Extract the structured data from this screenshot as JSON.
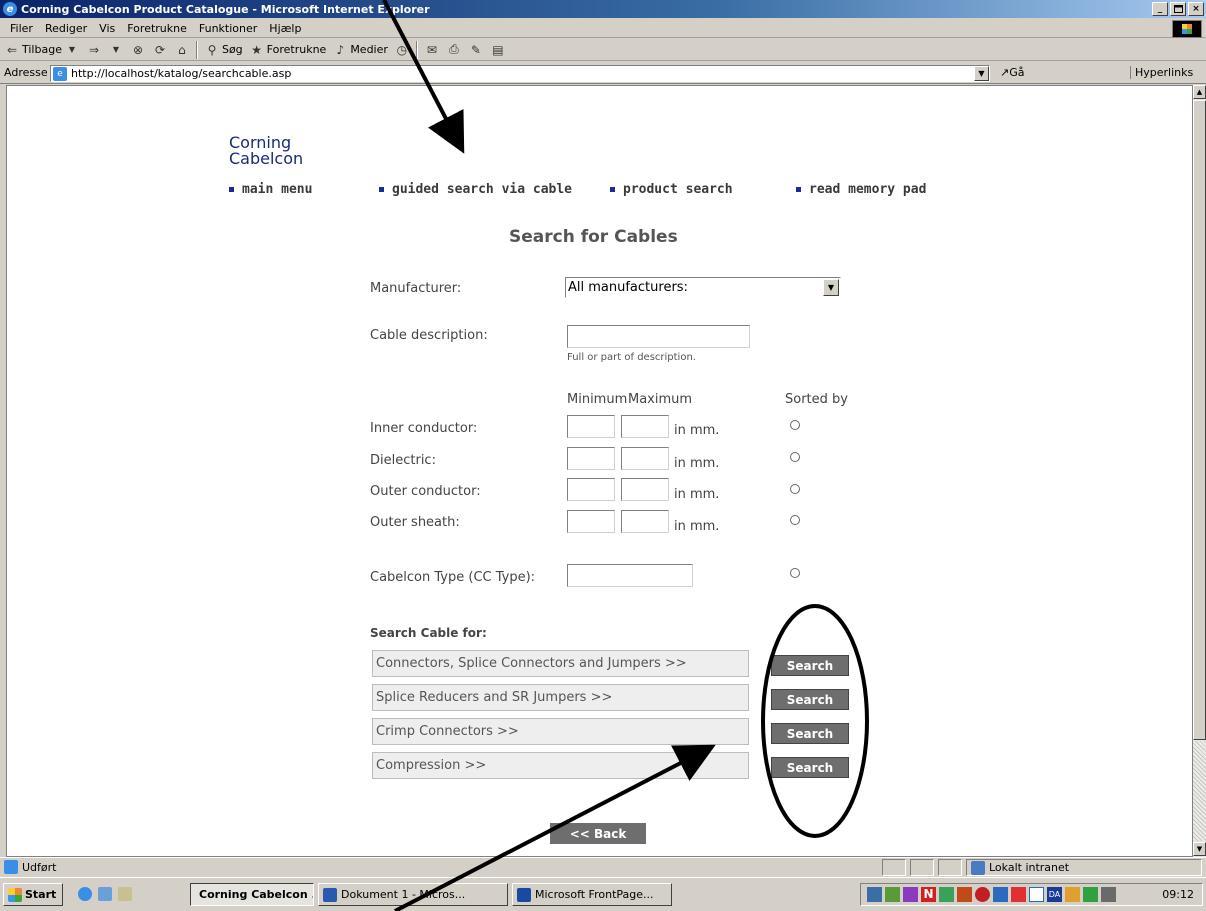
{
  "window": {
    "title": "Corning Cabelcon Product Catalogue - Microsoft Internet Explorer",
    "controls": [
      "_",
      "×"
    ]
  },
  "menu": [
    "Filer",
    "Rediger",
    "Vis",
    "Foretrukne",
    "Funktioner",
    "Hjælp"
  ],
  "toolbar": {
    "back": "Tilbage",
    "search": "Søg",
    "favorites": "Foretrukne",
    "media": "Medier"
  },
  "address": {
    "label": "Adresse",
    "url": "http://localhost/katalog/searchcable.asp",
    "go": "Gå",
    "links": "Hyperlinks"
  },
  "page": {
    "logo_line1": "Corning",
    "logo_line2": "Cabelcon",
    "nav": [
      "main menu",
      "guided search via cable",
      "product search",
      "read memory pad"
    ],
    "heading": "Search for Cables",
    "manufacturer_label": "Manufacturer:",
    "manufacturer_value": "All manufacturers:",
    "cable_desc_label": "Cable description:",
    "cable_desc_hint": "Full or part of description.",
    "col_min": "Minimum",
    "col_max": "Maximum",
    "col_sorted": "Sorted by",
    "dim_rows": [
      {
        "label": "Inner conductor:",
        "unit": "in mm."
      },
      {
        "label": "Dielectric:",
        "unit": "in mm."
      },
      {
        "label": "Outer conductor:",
        "unit": "in mm."
      },
      {
        "label": "Outer sheath:",
        "unit": "in mm."
      }
    ],
    "cc_type_label": "Cabelcon Type (CC Type):",
    "search_for_title": "Search Cable for:",
    "search_rows": [
      {
        "label": "Connectors, Splice Connectors and Jumpers >>",
        "button": "Search"
      },
      {
        "label": "Splice Reducers and SR Jumpers >>",
        "button": "Search"
      },
      {
        "label": "Crimp Connectors >>",
        "button": "Search"
      },
      {
        "label": "Compression >>",
        "button": "Search"
      }
    ],
    "back_button": "<< Back"
  },
  "status": {
    "text": "Udført",
    "zone": "Lokalt intranet"
  },
  "taskbar": {
    "start": "Start",
    "tasks": [
      "Corning Cabelcon ...",
      "Dokument 1 - Micros...",
      "Microsoft FrontPage..."
    ],
    "clock": "09:12",
    "tray_lang": "DA"
  },
  "colors": {
    "title_bar": "#0a246a",
    "logo": "#1a2a7a",
    "nav_bullet": "#1a2a9a",
    "search_button": "#6e6e6e"
  }
}
